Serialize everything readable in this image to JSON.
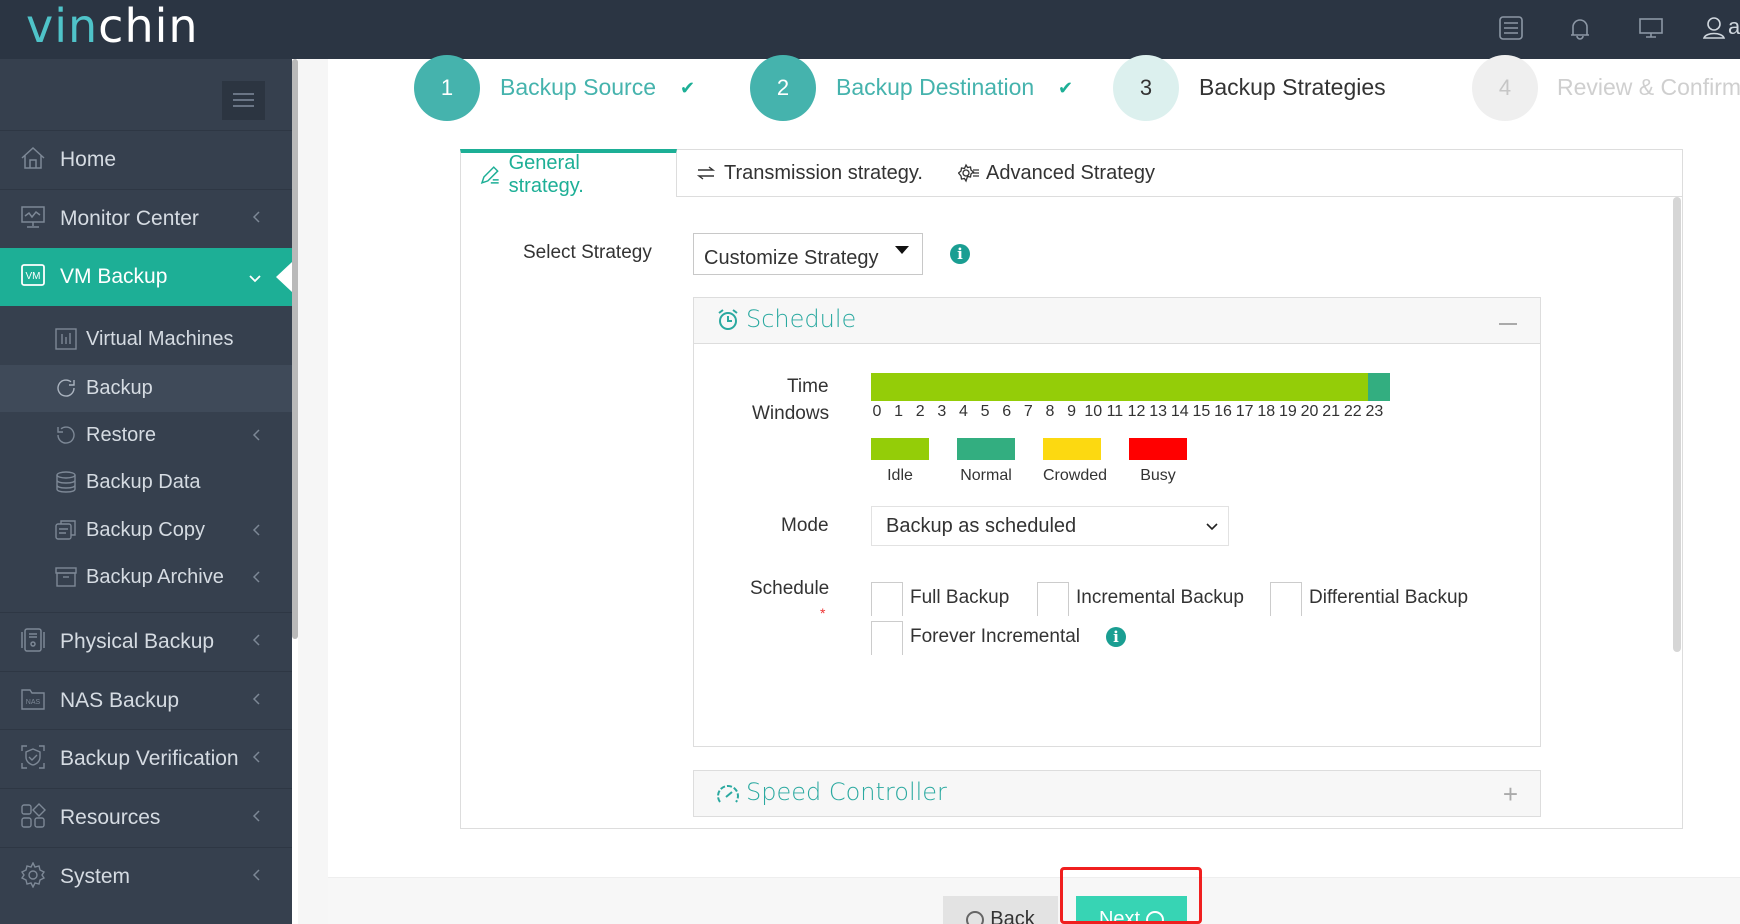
{
  "header": {
    "logo_prefix": "vin",
    "logo_suffix": "chin",
    "icons": [
      "task-list-icon",
      "bell-icon",
      "monitor-icon",
      "user-icon"
    ],
    "user_initial": "a"
  },
  "sidebar": {
    "items": [
      {
        "label": "Home",
        "icon": "home-icon"
      },
      {
        "label": "Monitor Center",
        "icon": "monitor-chart-icon"
      },
      {
        "label": "VM Backup",
        "icon": "vm-icon",
        "active": true
      },
      {
        "label": "Physical Backup",
        "icon": "server-icon"
      },
      {
        "label": "NAS Backup",
        "icon": "nas-icon"
      },
      {
        "label": "Backup Verification",
        "icon": "shield-check-icon"
      },
      {
        "label": "Resources",
        "icon": "grid-icon"
      },
      {
        "label": "System",
        "icon": "gear-icon"
      }
    ],
    "sub_items": [
      {
        "label": "Virtual Machines",
        "icon": "chart-box-icon"
      },
      {
        "label": "Backup",
        "icon": "refresh-icon",
        "selected": true
      },
      {
        "label": "Restore",
        "icon": "undo-icon"
      },
      {
        "label": "Backup Data",
        "icon": "database-icon"
      },
      {
        "label": "Backup Copy",
        "icon": "copy-icon"
      },
      {
        "label": "Backup Archive",
        "icon": "archive-icon"
      }
    ]
  },
  "wizard": {
    "steps": [
      {
        "number": "1",
        "label": "Backup Source",
        "state": "done"
      },
      {
        "number": "2",
        "label": "Backup Destination",
        "state": "done"
      },
      {
        "number": "3",
        "label": "Backup Strategies",
        "state": "current"
      },
      {
        "number": "4",
        "label": "Review & Confirm",
        "state": "pending"
      }
    ],
    "check": "✔"
  },
  "tabs": [
    {
      "label": "General strategy.",
      "icon": "edit-icon",
      "active": true
    },
    {
      "label": "Transmission strategy.",
      "icon": "exchange-icon"
    },
    {
      "label": "Advanced Strategy",
      "icon": "advanced-gear-icon"
    }
  ],
  "strategy": {
    "label": "Select Strategy",
    "value": "Customize Strategy"
  },
  "schedule_panel": {
    "title": "Schedule",
    "collapse_symbol": "—",
    "time_windows_label_1": "Time",
    "time_windows_label_2": "Windows",
    "hours": [
      "0",
      "1",
      "2",
      "3",
      "4",
      "5",
      "6",
      "7",
      "8",
      "9",
      "10",
      "11",
      "12",
      "13",
      "14",
      "15",
      "16",
      "17",
      "18",
      "19",
      "20",
      "21",
      "22",
      "23"
    ],
    "hour_states": [
      "idle",
      "idle",
      "idle",
      "idle",
      "idle",
      "idle",
      "idle",
      "idle",
      "idle",
      "idle",
      "idle",
      "idle",
      "idle",
      "idle",
      "idle",
      "idle",
      "idle",
      "idle",
      "idle",
      "idle",
      "idle",
      "idle",
      "idle",
      "normal"
    ],
    "legend": [
      {
        "label": "Idle",
        "key": "idle",
        "color": "#94cd08"
      },
      {
        "label": "Normal",
        "key": "normal",
        "color": "#33ae80"
      },
      {
        "label": "Crowded",
        "key": "crowded",
        "color": "#fcd911"
      },
      {
        "label": "Busy",
        "key": "busy",
        "color": "#ff0000"
      }
    ],
    "mode_label": "Mode",
    "mode_value": "Backup as scheduled",
    "schedule_label": "Schedule",
    "required_mark": "*",
    "options": [
      "Full Backup",
      "Incremental Backup",
      "Differential Backup",
      "Forever Incremental"
    ]
  },
  "speed_panel": {
    "title": "Speed Controller",
    "expand_symbol": "+"
  },
  "footer": {
    "back_label": "Back",
    "next_label": "Next"
  },
  "colors": {
    "accent": "#1daf96",
    "header_bg": "#2b3543",
    "sidebar_bg": "#36404e"
  }
}
